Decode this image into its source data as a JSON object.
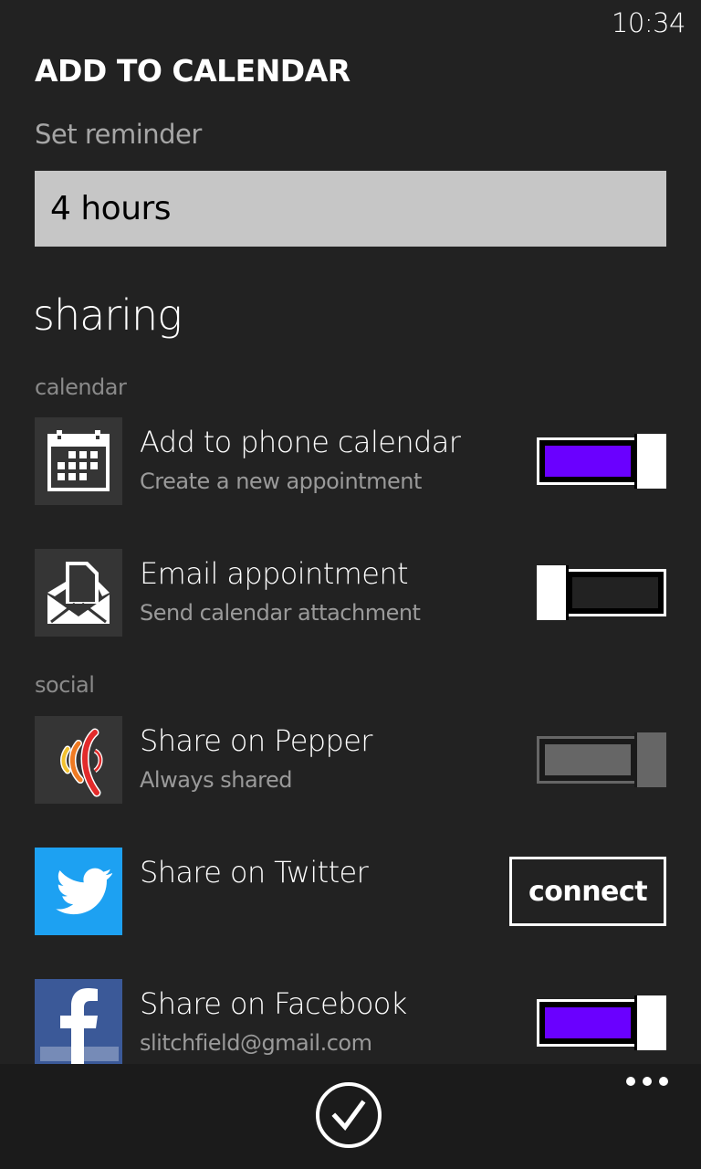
{
  "status_bar": {
    "time": "10:34"
  },
  "header": {
    "title": "ADD TO CALENDAR"
  },
  "reminder": {
    "label": "Set reminder",
    "value": "4 hours"
  },
  "sharing": {
    "title": "sharing",
    "groups": [
      {
        "label": "calendar",
        "items": [
          {
            "title": "Add to phone calendar",
            "subtitle": "Create a new appointment",
            "icon": "calendar-icon",
            "control": "toggle",
            "state": "on"
          },
          {
            "title": "Email appointment",
            "subtitle": "Send calendar attachment",
            "icon": "email-open-icon",
            "control": "toggle",
            "state": "off"
          }
        ]
      },
      {
        "label": "social",
        "items": [
          {
            "title": "Share on Pepper",
            "subtitle": "Always shared",
            "icon": "pepper-icon",
            "control": "toggle",
            "state": "on-disabled"
          },
          {
            "title": "Share on Twitter",
            "subtitle": "",
            "icon": "twitter-icon",
            "control": "button",
            "button_label": "connect"
          },
          {
            "title": "Share on Facebook",
            "subtitle": "slitchfield@gmail.com",
            "icon": "facebook-icon",
            "control": "toggle",
            "state": "on"
          }
        ]
      }
    ]
  },
  "app_bar": {
    "primary_icon": "check-icon",
    "more_icon": "more-icon"
  },
  "colors": {
    "background": "#222222",
    "accent": "#6a00ff",
    "twitter": "#1da1f2",
    "facebook": "#3b5998",
    "app_bar": "#1b1b1b"
  }
}
